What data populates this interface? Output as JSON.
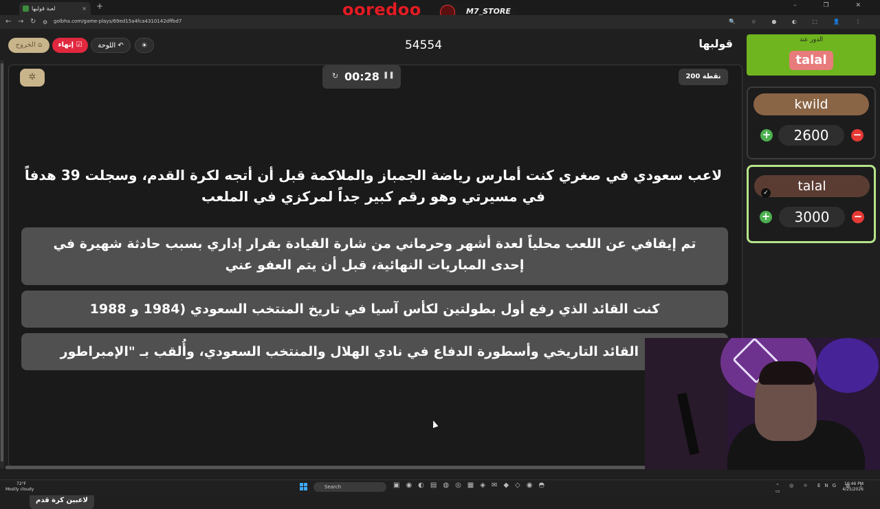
{
  "browser": {
    "tab_title": "لعبة قولبها",
    "tab_close": "×",
    "new_tab": "+",
    "url": "golbha.com/game-plays/69ed15a4fca4310142dffbd7",
    "window_controls": "– ❐ ✕",
    "extension_icons": "🔍 ☆ ● ◐ ⬚ 👤 ⋮",
    "stream_overlay": {
      "brand": "ooredoo",
      "store": "M7_STORE"
    }
  },
  "header": {
    "brand": "قولبها",
    "game_code": "54554",
    "exit_label": "الخروج",
    "end_label": "إنهاء",
    "board_label": "اللوحة",
    "theme_icon": "☀"
  },
  "question_panel": {
    "timer": "00:28",
    "points": "200 نقطة",
    "question": "لاعب سعودي في صغري كنت أمارس رياضة الجمباز والملاكمة قبل أن أتجه لكرة القدم، وسجلت 39 هدفاً في مسيرتي وهو رقم كبير جداً لمركزي في الملعب",
    "answers": [
      "تم إيقافي عن اللعب محلياً لعدة أشهر وحرماني من شارة القيادة بقرار إداري بسبب حادثة شهيرة في إحدى المباريات النهائية، قبل أن يتم العفو عني",
      "كنت القائد الذي رفع أول بطولتين لكأس آسيا في تاريخ المنتخب السعودي (1984 و 1988",
      "القائد التاريخي وأسطورة الدفاع في نادي الهلال والمنتخب السعودي، وأُلقب بـ \"الإمبراطور"
    ],
    "category": "لاعبين كرة قدم"
  },
  "sidebar": {
    "turn_label": "الدور عند",
    "turn_team": "talal",
    "teams": [
      {
        "name": "kwild",
        "score": "2600"
      },
      {
        "name": "talal",
        "score": "3000"
      }
    ]
  },
  "taskbar": {
    "temperature": "72°F",
    "weather": "Mostly cloudy",
    "search_placeholder": "Search",
    "language": "ENG",
    "time": "10:46 PM",
    "date": "4/25/2026"
  },
  "colors": {
    "turn_bg": "#6fb51f",
    "end_button": "#e0283e",
    "active_team_border": "#b7e48a",
    "answer_bg": "#505050"
  }
}
